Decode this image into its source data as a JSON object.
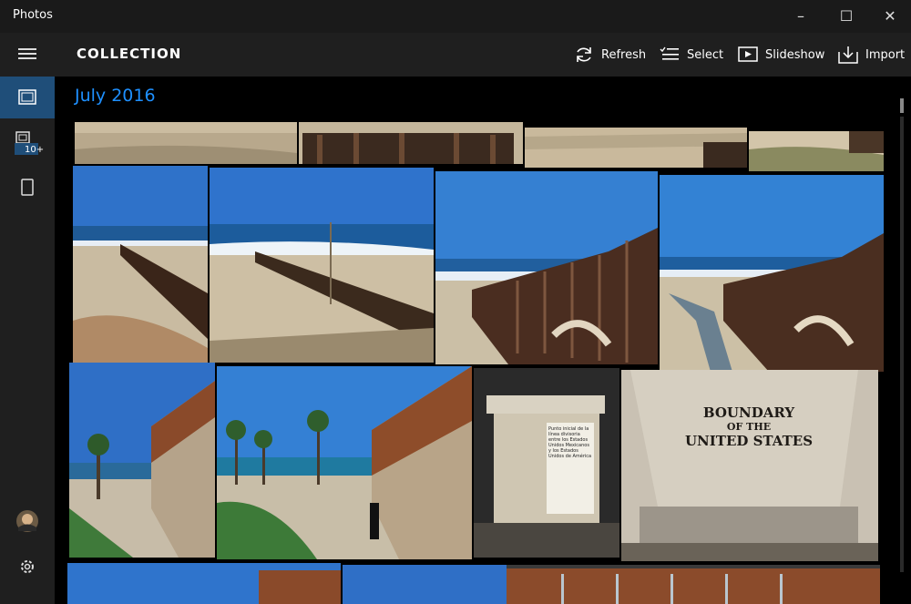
{
  "window": {
    "title": "Photos",
    "minimize": "–",
    "maximize": "☐",
    "close": "✕"
  },
  "header": {
    "title": "COLLECTION"
  },
  "toolbar": {
    "refresh": "Refresh",
    "select": "Select",
    "slideshow": "Slideshow",
    "import": "Import"
  },
  "sidebar": {
    "albums_badge": "10+"
  },
  "content": {
    "month": "July 2016"
  },
  "photos": {
    "plaque_text": "Punto inicial de la línea divisoria entre los Estados Unidos Mexicanos y los Estados Unidos de América",
    "marker_line1": "BOUNDARY",
    "marker_line2": "OF THE",
    "marker_line3": "UNITED STATES"
  },
  "colors": {
    "accent": "#1e90ff",
    "active_nav": "#1f4e79",
    "chrome": "#1f1f1f"
  }
}
